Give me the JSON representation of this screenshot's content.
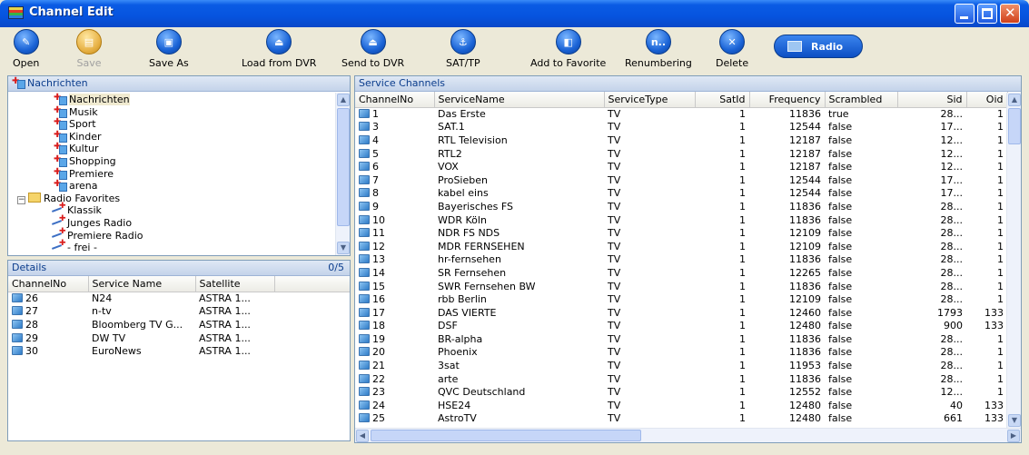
{
  "window": {
    "title": "Channel Edit"
  },
  "toolbar": [
    {
      "label": "Open",
      "glyph": "✎",
      "disabled": false
    },
    {
      "label": "Save",
      "glyph": "▤",
      "disabled": true
    },
    {
      "label": "Save As",
      "glyph": "▣",
      "disabled": false
    },
    {
      "label": "Load from DVR",
      "glyph": "⏏",
      "disabled": false
    },
    {
      "label": "Send to DVR",
      "glyph": "⏏",
      "disabled": false
    },
    {
      "label": "SAT/TP",
      "glyph": "⚓",
      "disabled": false
    },
    {
      "label": "Add to Favorite",
      "glyph": "◧",
      "disabled": false
    },
    {
      "label": "Renumbering",
      "glyph": "n..",
      "disabled": false
    },
    {
      "label": "Delete",
      "glyph": "✕",
      "disabled": false
    }
  ],
  "radio_button": {
    "label": "Radio"
  },
  "favorites_panel": {
    "header": "Nachrichten",
    "items": [
      {
        "label": "Nachrichten",
        "type": "tv",
        "selected": true
      },
      {
        "label": "Musik",
        "type": "tv"
      },
      {
        "label": "Sport",
        "type": "tv"
      },
      {
        "label": "Kinder",
        "type": "tv"
      },
      {
        "label": "Kultur",
        "type": "tv"
      },
      {
        "label": "Shopping",
        "type": "tv"
      },
      {
        "label": "Premiere",
        "type": "tv"
      },
      {
        "label": "arena",
        "type": "tv"
      },
      {
        "label": "Radio Favorites",
        "type": "folder",
        "expander": "−"
      },
      {
        "label": "Klassik",
        "type": "radio"
      },
      {
        "label": "Junges Radio",
        "type": "radio"
      },
      {
        "label": "Premiere Radio",
        "type": "radio"
      },
      {
        "label": "- frei -",
        "type": "radio"
      }
    ]
  },
  "details_panel": {
    "header": "Details",
    "count": "0/5",
    "columns": [
      "ChannelNo",
      "Service Name",
      "Satellite"
    ],
    "rows": [
      [
        "26",
        "N24",
        "ASTRA 1..."
      ],
      [
        "27",
        "n-tv",
        "ASTRA 1..."
      ],
      [
        "28",
        "Bloomberg TV G...",
        "ASTRA 1..."
      ],
      [
        "29",
        "DW TV",
        "ASTRA 1..."
      ],
      [
        "30",
        "EuroNews",
        "ASTRA 1..."
      ]
    ]
  },
  "service_panel": {
    "header": "Service Channels",
    "columns": [
      "ChannelNo",
      "ServiceName",
      "ServiceType",
      "SatId",
      "Frequency",
      "Scrambled",
      "Sid",
      "Oid"
    ],
    "rows": [
      [
        "1",
        "Das Erste",
        "TV",
        "1",
        "11836",
        "true",
        "28...",
        "1"
      ],
      [
        "3",
        "SAT.1",
        "TV",
        "1",
        "12544",
        "false",
        "17...",
        "1"
      ],
      [
        "4",
        "RTL Television",
        "TV",
        "1",
        "12187",
        "false",
        "12...",
        "1"
      ],
      [
        "5",
        "RTL2",
        "TV",
        "1",
        "12187",
        "false",
        "12...",
        "1"
      ],
      [
        "6",
        "VOX",
        "TV",
        "1",
        "12187",
        "false",
        "12...",
        "1"
      ],
      [
        "7",
        "ProSieben",
        "TV",
        "1",
        "12544",
        "false",
        "17...",
        "1"
      ],
      [
        "8",
        "kabel eins",
        "TV",
        "1",
        "12544",
        "false",
        "17...",
        "1"
      ],
      [
        "9",
        "Bayerisches FS",
        "TV",
        "1",
        "11836",
        "false",
        "28...",
        "1"
      ],
      [
        "10",
        "WDR Köln",
        "TV",
        "1",
        "11836",
        "false",
        "28...",
        "1"
      ],
      [
        "11",
        "NDR FS NDS",
        "TV",
        "1",
        "12109",
        "false",
        "28...",
        "1"
      ],
      [
        "12",
        "MDR FERNSEHEN",
        "TV",
        "1",
        "12109",
        "false",
        "28...",
        "1"
      ],
      [
        "13",
        "hr-fernsehen",
        "TV",
        "1",
        "11836",
        "false",
        "28...",
        "1"
      ],
      [
        "14",
        "SR Fernsehen",
        "TV",
        "1",
        "12265",
        "false",
        "28...",
        "1"
      ],
      [
        "15",
        "SWR Fernsehen BW",
        "TV",
        "1",
        "11836",
        "false",
        "28...",
        "1"
      ],
      [
        "16",
        "rbb Berlin",
        "TV",
        "1",
        "12109",
        "false",
        "28...",
        "1"
      ],
      [
        "17",
        "DAS VIERTE",
        "TV",
        "1",
        "12460",
        "false",
        "1793",
        "133"
      ],
      [
        "18",
        "DSF",
        "TV",
        "1",
        "12480",
        "false",
        "900",
        "133"
      ],
      [
        "19",
        "BR-alpha",
        "TV",
        "1",
        "11836",
        "false",
        "28...",
        "1"
      ],
      [
        "20",
        "Phoenix",
        "TV",
        "1",
        "11836",
        "false",
        "28...",
        "1"
      ],
      [
        "21",
        "3sat",
        "TV",
        "1",
        "11953",
        "false",
        "28...",
        "1"
      ],
      [
        "22",
        "arte",
        "TV",
        "1",
        "11836",
        "false",
        "28...",
        "1"
      ],
      [
        "23",
        "QVC Deutschland",
        "TV",
        "1",
        "12552",
        "false",
        "12...",
        "1"
      ],
      [
        "24",
        "HSE24",
        "TV",
        "1",
        "12480",
        "false",
        "40",
        "133"
      ],
      [
        "25",
        "AstroTV",
        "TV",
        "1",
        "12480",
        "false",
        "661",
        "133"
      ]
    ]
  }
}
